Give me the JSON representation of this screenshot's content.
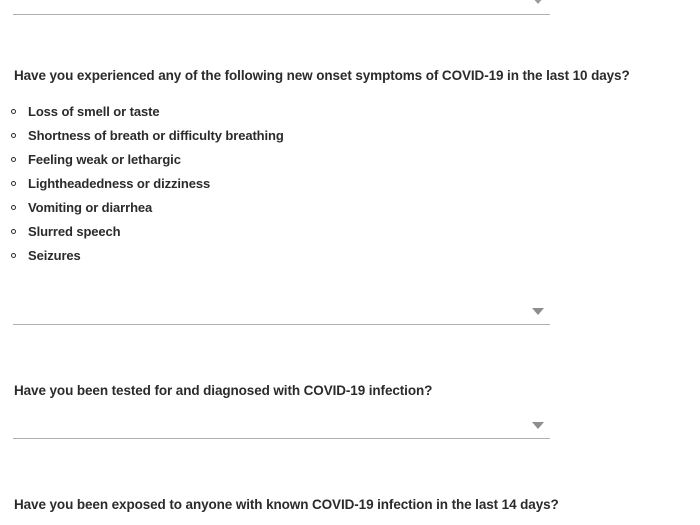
{
  "form": {
    "background_color": "#ffffff",
    "text_color": "#2b2b2b",
    "line_color": "#b0b0b0",
    "caret_color": "#8e8e8e"
  },
  "top_partial_field": {
    "name": "partial-dropdown-above",
    "value": "",
    "caret_icon": "chevron-down-icon"
  },
  "questions": [
    {
      "id": "covid-symptoms",
      "label": "Have you experienced any of the following new onset symptoms of COVID-19 in the last 10 days?",
      "options": [
        "Loss of smell or taste",
        "Shortness of breath or difficulty breathing",
        "Feeling weak or lethargic",
        "Lightheadedness or dizziness",
        "Vomiting or diarrhea",
        "Slurred speech",
        "Seizures"
      ],
      "answer": {
        "value": "",
        "placeholder": "",
        "caret_icon": "chevron-down-icon"
      }
    },
    {
      "id": "covid-tested-diagnosed",
      "label": "Have you been tested for and diagnosed with COVID-19 infection?",
      "answer": {
        "value": "",
        "placeholder": "",
        "caret_icon": "chevron-down-icon"
      }
    },
    {
      "id": "covid-exposure",
      "label": "Have you been exposed to anyone with known COVID-19 infection in the last 14 days?"
    }
  ]
}
